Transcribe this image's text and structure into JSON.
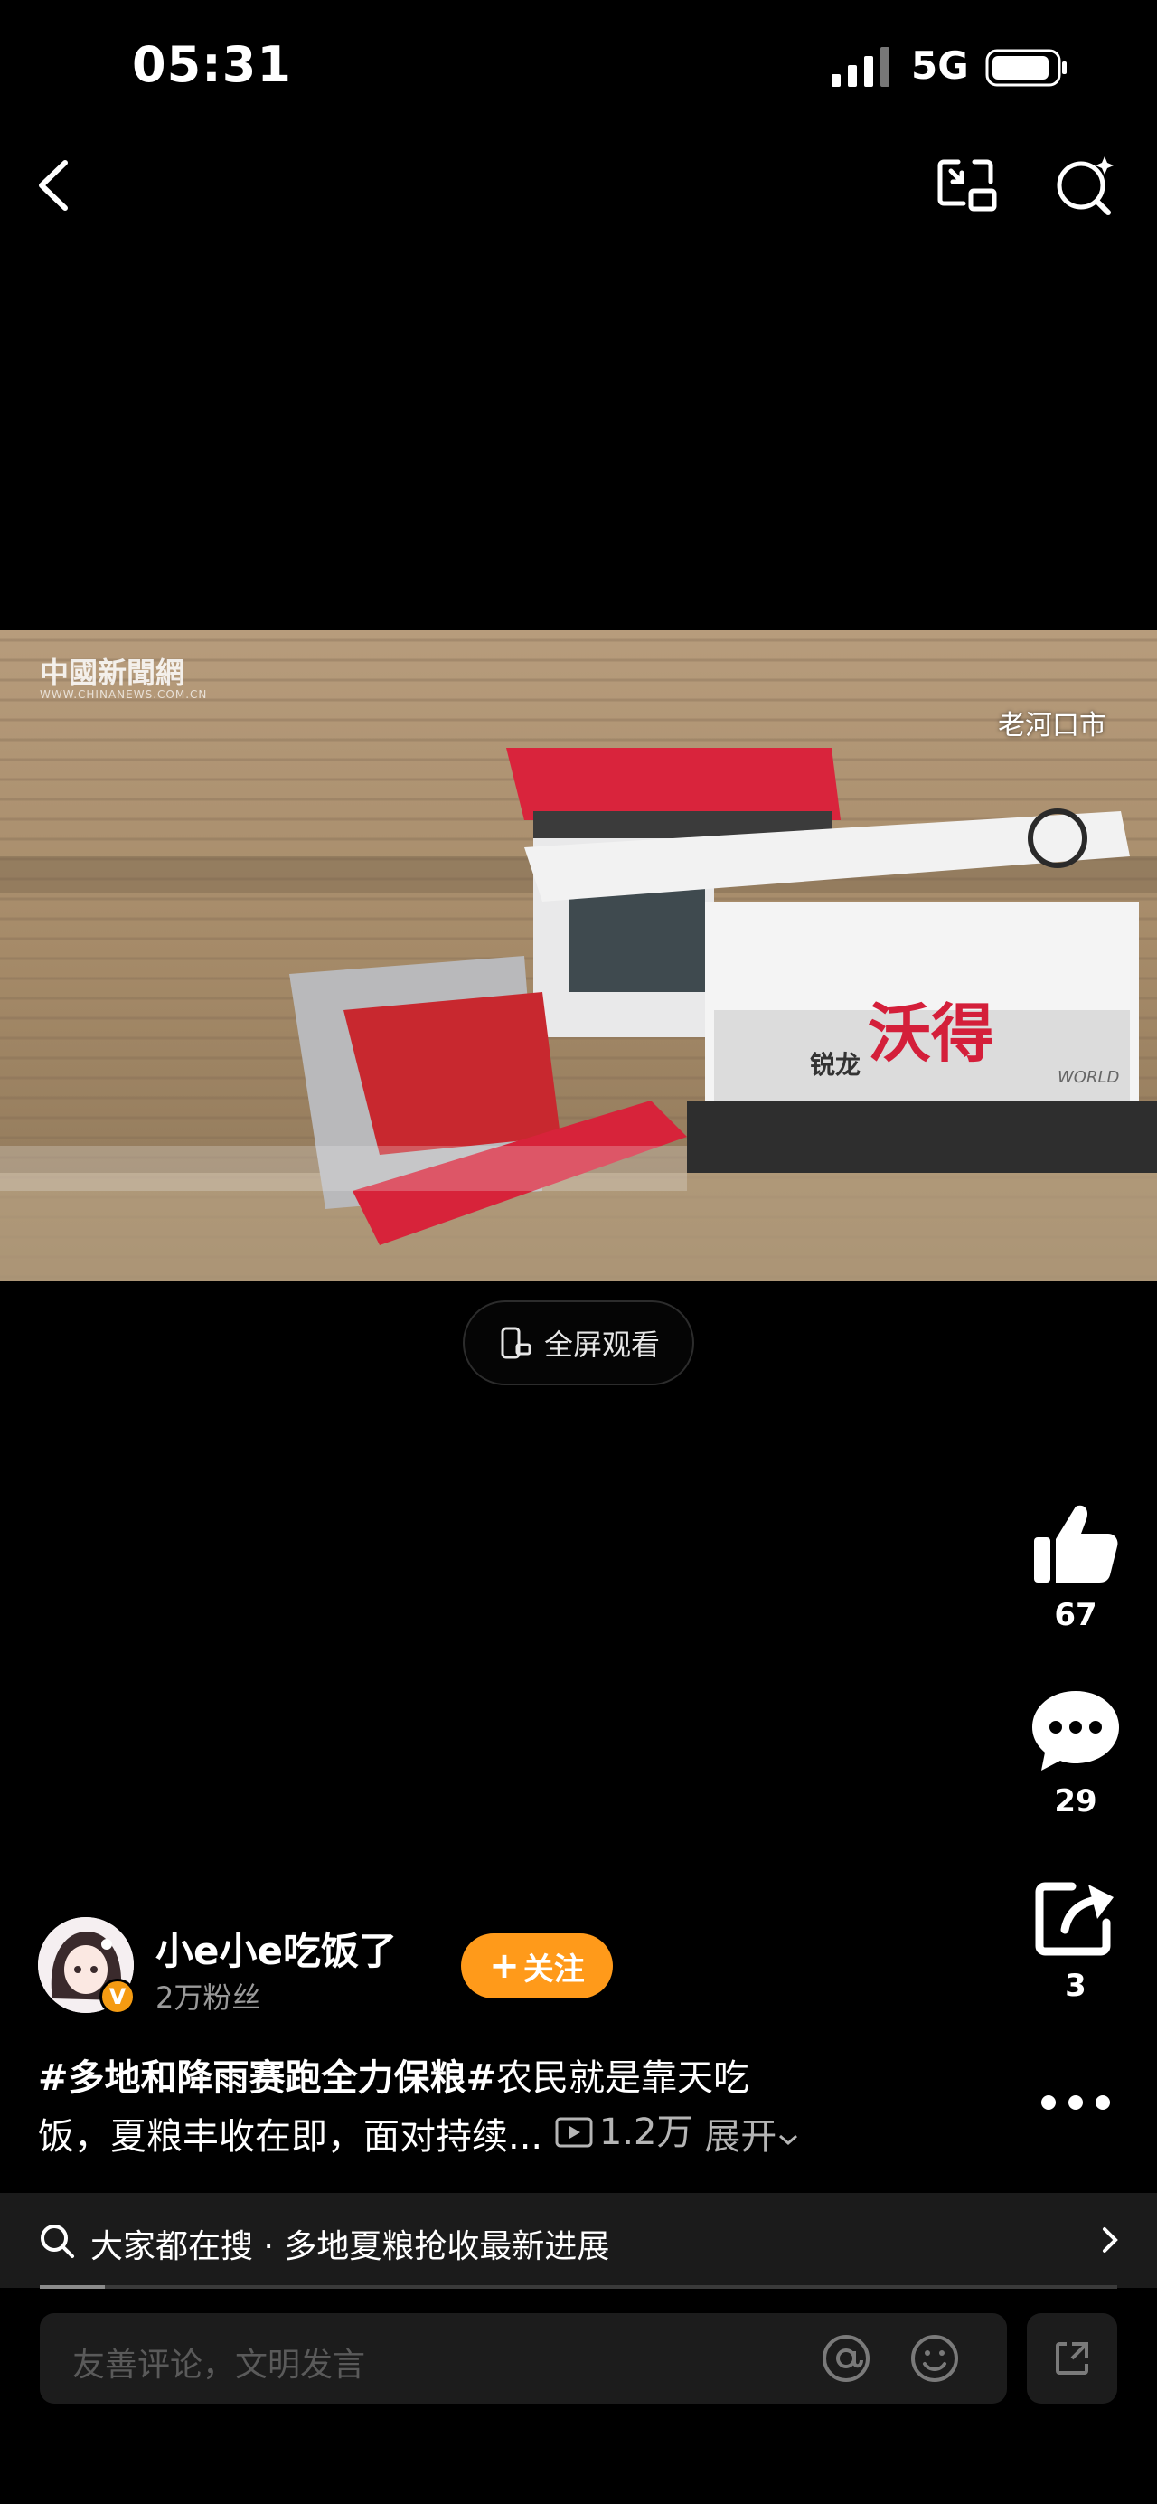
{
  "status_bar": {
    "time": "05:31",
    "network": "5G"
  },
  "video": {
    "watermark": "中國新聞網",
    "watermark_sub": "WWW.CHINANEWS.COM.CN",
    "location": "老河口市"
  },
  "fullscreen": {
    "label": "全屏观看"
  },
  "actions": {
    "likes": "67",
    "comments": "29",
    "shares": "3"
  },
  "author": {
    "name": "小e小e吃饭了",
    "fans": "2万粉丝",
    "follow_label": "关注",
    "verified_mark": "V"
  },
  "caption": {
    "hashtag": "#多地和降雨赛跑全力保粮#",
    "text_line1": "农民就是靠天吃",
    "text_line2": "饭，夏粮丰收在即，面对持续...",
    "plays": "1.2万",
    "expand": "展开"
  },
  "search_suggestion": {
    "prefix": "大家都在搜",
    "separator": "·",
    "query": "多地夏粮抢收最新进展"
  },
  "playback": {
    "progress_fraction": 0.06
  },
  "comment": {
    "placeholder": "友善评论，文明发言"
  }
}
